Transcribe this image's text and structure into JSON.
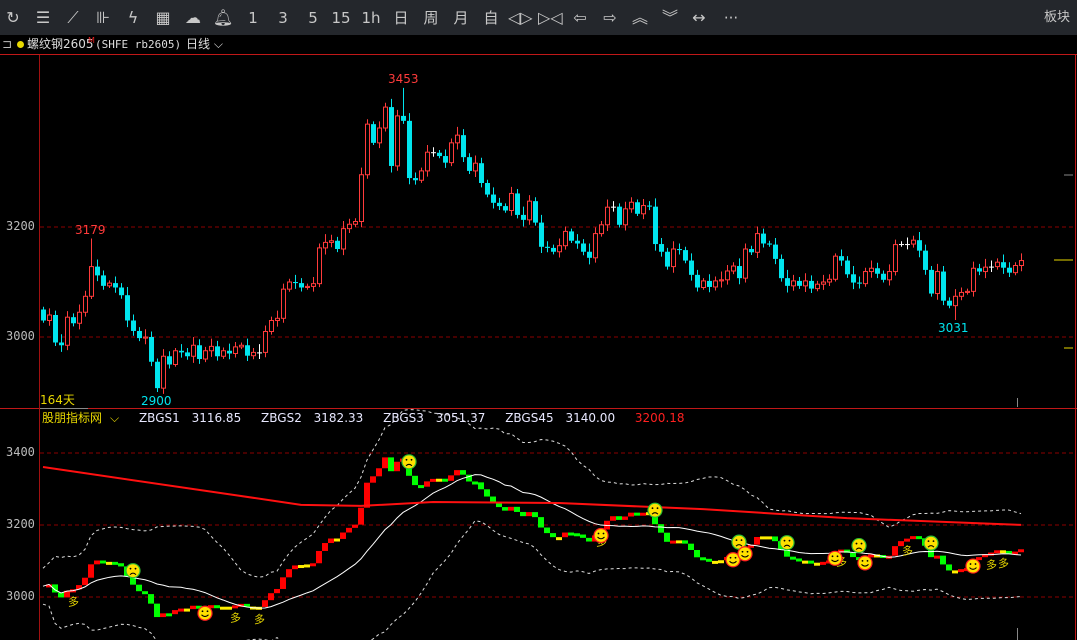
{
  "toolbar": {
    "items": [
      {
        "name": "refresh-icon",
        "label": ""
      },
      {
        "name": "list-icon",
        "label": ""
      },
      {
        "name": "line-chart-icon",
        "label": ""
      },
      {
        "name": "candlestick-icon",
        "label": ""
      },
      {
        "name": "lightning-icon",
        "label": ""
      },
      {
        "name": "order-icon",
        "label": ""
      },
      {
        "name": "cloud-icon",
        "label": ""
      },
      {
        "name": "bell-icon",
        "label": ""
      },
      {
        "name": "period-1",
        "label": "1"
      },
      {
        "name": "period-3",
        "label": "3"
      },
      {
        "name": "period-5",
        "label": "5"
      },
      {
        "name": "period-15",
        "label": "15"
      },
      {
        "name": "period-1h",
        "label": "1h"
      },
      {
        "name": "period-day",
        "label": "日"
      },
      {
        "name": "period-week",
        "label": "周"
      },
      {
        "name": "period-month",
        "label": "月"
      },
      {
        "name": "period-custom",
        "label": "自"
      },
      {
        "name": "zoom-out-icon",
        "label": ""
      },
      {
        "name": "zoom-in-icon",
        "label": ""
      },
      {
        "name": "arrow-left-icon",
        "label": ""
      },
      {
        "name": "arrow-right-icon",
        "label": ""
      },
      {
        "name": "chevron-double-up-icon",
        "label": ""
      },
      {
        "name": "chevron-double-down-icon",
        "label": ""
      },
      {
        "name": "expand-horizontal-icon",
        "label": ""
      },
      {
        "name": "more-icon",
        "label": "···"
      }
    ],
    "sector_label": "板块"
  },
  "info": {
    "symbol_name": "螺纹钢2605",
    "badge": "M",
    "code": "(SHFE rb2605)",
    "period": "日线",
    "status_color": "#e8d800"
  },
  "main_chart": {
    "y_ticks": [
      "3200",
      "3000"
    ],
    "high_label": "3453",
    "low_label": "2900",
    "local_high_label": "3179",
    "local_low_label": "3031",
    "days_label": "164天",
    "colors": {
      "up": "#ff3b3b",
      "down": "#00e5ee",
      "grid": "#8b0000"
    }
  },
  "indicator": {
    "name": "股朋指标网",
    "values": [
      {
        "label": "ZBGS1",
        "value": "3116.85"
      },
      {
        "label": "ZBGS2",
        "value": "3182.33"
      },
      {
        "label": "ZBGS3",
        "value": "3051.37"
      },
      {
        "label": "ZBGS45",
        "value": "3140.00"
      }
    ],
    "red_value": "3200.18",
    "y_ticks": [
      "3400",
      "3200",
      "3000"
    ],
    "signal_text": "多",
    "long_ma_points": [
      [
        0,
        3361
      ],
      [
        32,
        3283
      ],
      [
        43,
        3256
      ],
      [
        53,
        3253
      ],
      [
        65,
        3264
      ],
      [
        86,
        3261
      ],
      [
        110,
        3244
      ],
      [
        134,
        3219
      ],
      [
        163,
        3200.18
      ]
    ],
    "signals": [
      {
        "index": 15,
        "type": "frown"
      },
      {
        "index": 27,
        "type": "smile"
      },
      {
        "index": 61,
        "type": "frown"
      },
      {
        "index": 93,
        "type": "smile"
      },
      {
        "index": 102,
        "type": "frown"
      },
      {
        "index": 115,
        "type": "smile"
      },
      {
        "index": 116,
        "type": "frown"
      },
      {
        "index": 117,
        "type": "smile"
      },
      {
        "index": 124,
        "type": "frown"
      },
      {
        "index": 132,
        "type": "smile"
      },
      {
        "index": 136,
        "type": "frown"
      },
      {
        "index": 137,
        "type": "smile"
      },
      {
        "index": 148,
        "type": "frown"
      },
      {
        "index": 155,
        "type": "smile"
      }
    ],
    "duo_indices": [
      5,
      32,
      36,
      93,
      133,
      144,
      158,
      160
    ]
  },
  "chart_data": {
    "type": "candlestick",
    "title": "",
    "ylim": [
      2860,
      3520
    ],
    "close": [
      3030,
      3040,
      2990,
      2985,
      3036,
      3025,
      3045,
      3074,
      3128,
      3112,
      3093,
      3098,
      3090,
      3076,
      3030,
      3011,
      2998,
      3000,
      2955,
      2907,
      2965,
      2950,
      2975,
      2972,
      2965,
      2985,
      2960,
      2975,
      2983,
      2965,
      2975,
      2970,
      2982,
      2985,
      2966,
      2972,
      2972,
      3010,
      3030,
      3034,
      3087,
      3100,
      3098,
      3090,
      3092,
      3097,
      3162,
      3172,
      3175,
      3160,
      3197,
      3205,
      3210,
      3295,
      3387,
      3353,
      3380,
      3418,
      3311,
      3402,
      3393,
      3289,
      3285,
      3302,
      3336,
      3335,
      3329,
      3317,
      3353,
      3367,
      3327,
      3302,
      3316,
      3280,
      3259,
      3244,
      3238,
      3230,
      3261,
      3222,
      3213,
      3247,
      3208,
      3164,
      3162,
      3155,
      3166,
      3192,
      3175,
      3170,
      3155,
      3144,
      3188,
      3204,
      3236,
      3237,
      3204,
      3233,
      3245,
      3224,
      3239,
      3237,
      3169,
      3155,
      3128,
      3160,
      3158,
      3139,
      3113,
      3090,
      3102,
      3091,
      3102,
      3104,
      3120,
      3129,
      3107,
      3160,
      3154,
      3188,
      3170,
      3168,
      3142,
      3107,
      3093,
      3102,
      3093,
      3102,
      3088,
      3096,
      3100,
      3105,
      3147,
      3139,
      3114,
      3099,
      3097,
      3119,
      3125,
      3115,
      3104,
      3119,
      3168,
      3169,
      3169,
      3176,
      3157,
      3122,
      3079,
      3119,
      3066,
      3057,
      3074,
      3081,
      3083,
      3125,
      3119,
      3127,
      3128,
      3136,
      3126,
      3117,
      3130,
      3139
    ],
    "first_open": 3050,
    "extremes": {
      "8": {
        "high": 3179
      },
      "19": {
        "low": 2900
      },
      "60": {
        "high": 3453
      },
      "152": {
        "low": 3031
      }
    }
  }
}
